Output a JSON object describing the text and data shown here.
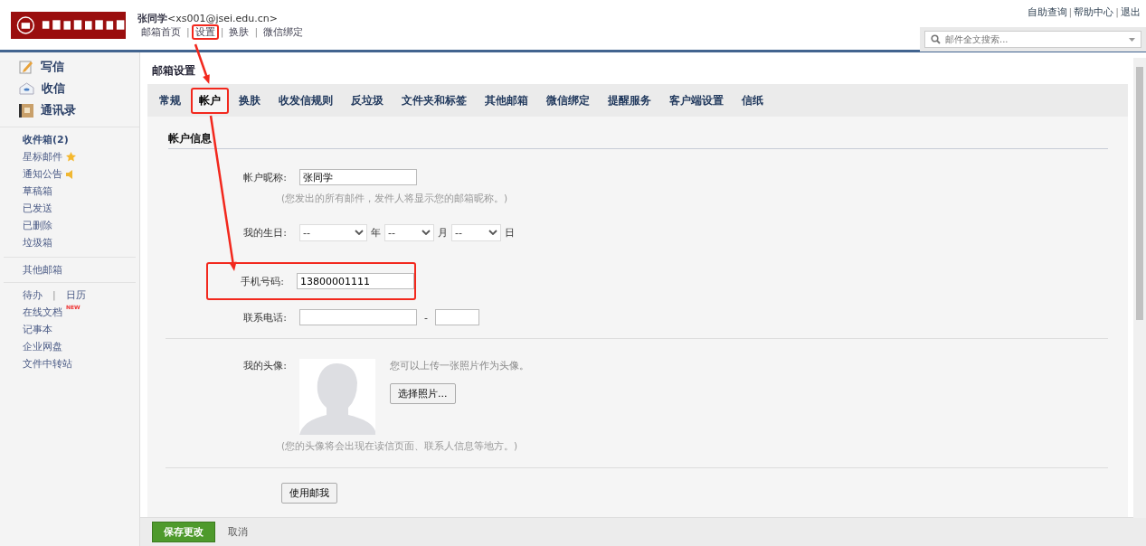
{
  "header": {
    "user_name": "张同学",
    "user_email": "<xs001@jsei.edu.cn>",
    "nav_links": [
      {
        "label": "邮箱首页",
        "highlighted": false
      },
      {
        "label": "设置",
        "highlighted": true
      },
      {
        "label": "换肤",
        "highlighted": false
      },
      {
        "label": "微信绑定",
        "highlighted": false
      }
    ],
    "nav_separator": "|",
    "top_links": [
      "自助查询",
      "帮助中心",
      "退出"
    ],
    "top_separator": "|",
    "search": {
      "placeholder": "邮件全文搜索..."
    }
  },
  "sidebar": {
    "main_actions": [
      {
        "label": "写信",
        "kind": "compose"
      },
      {
        "label": "收信",
        "kind": "inbox"
      },
      {
        "label": "通讯录",
        "kind": "contacts"
      }
    ],
    "folders": [
      {
        "label": "收件箱(2)",
        "bold": true,
        "kind": "plain"
      },
      {
        "label": "星标邮件",
        "bold": false,
        "kind": "starred"
      },
      {
        "label": "通知公告",
        "bold": false,
        "kind": "notice"
      },
      {
        "label": "草稿箱",
        "bold": false,
        "kind": "plain"
      },
      {
        "label": "已发送",
        "bold": false,
        "kind": "plain"
      },
      {
        "label": "已删除",
        "bold": false,
        "kind": "plain"
      },
      {
        "label": "垃圾箱",
        "bold": false,
        "kind": "plain"
      }
    ],
    "other": "其他邮箱",
    "tools_row": [
      "待办",
      "日历"
    ],
    "tools_separator": "|",
    "tools": [
      {
        "label": "在线文档",
        "tag": "NEW"
      },
      {
        "label": "记事本"
      },
      {
        "label": "企业网盘"
      },
      {
        "label": "文件中转站"
      }
    ]
  },
  "page_title": "邮箱设置",
  "tabs": [
    {
      "label": "常规",
      "selected": false,
      "highlighted": false
    },
    {
      "label": "帐户",
      "selected": true,
      "highlighted": true
    },
    {
      "label": "换肤",
      "selected": false,
      "highlighted": false
    },
    {
      "label": "收发信规则",
      "selected": false,
      "highlighted": false
    },
    {
      "label": "反垃圾",
      "selected": false,
      "highlighted": false
    },
    {
      "label": "文件夹和标签",
      "selected": false,
      "highlighted": false
    },
    {
      "label": "其他邮箱",
      "selected": false,
      "highlighted": false
    },
    {
      "label": "微信绑定",
      "selected": false,
      "highlighted": false
    },
    {
      "label": "提醒服务",
      "selected": false,
      "highlighted": false
    },
    {
      "label": "客户端设置",
      "selected": false,
      "highlighted": false
    },
    {
      "label": "信纸",
      "selected": false,
      "highlighted": false
    }
  ],
  "section_title": "帐户信息",
  "nickname": {
    "label": "帐户昵称:",
    "value": "张同学",
    "hint": "(您发出的所有邮件，发件人将显示您的邮箱昵称。)"
  },
  "birthday": {
    "label": "我的生日:",
    "year": "--",
    "year_unit": "年",
    "month": "--",
    "month_unit": "月",
    "day": "--",
    "day_unit": "日"
  },
  "mobile": {
    "label": "手机号码:",
    "value": "13800001111",
    "highlighted": true
  },
  "phone": {
    "label": "联系电话:",
    "separator": "-"
  },
  "avatar": {
    "label": "我的头像:",
    "note": "您可以上传一张照片作为头像。",
    "button": "选择照片...",
    "hint": "(您的头像将会出现在读信页面、联系人信息等地方。)"
  },
  "card_button": "使用邮我",
  "footer": {
    "save": "保存更改",
    "cancel": "取消"
  }
}
